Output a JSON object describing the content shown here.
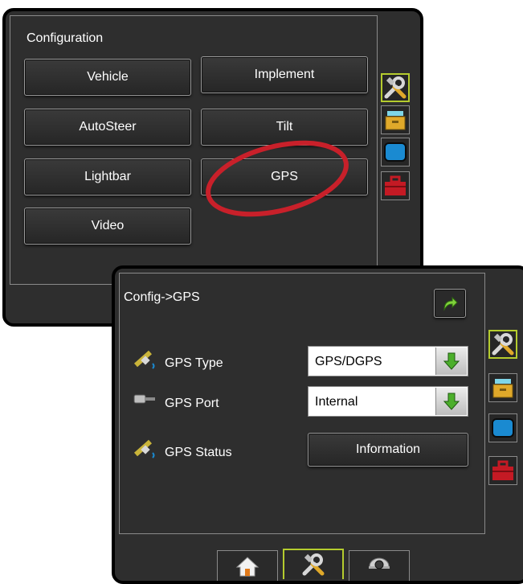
{
  "config": {
    "title": "Configuration",
    "buttons": {
      "vehicle": "Vehicle",
      "implement": "Implement",
      "autosteer": "AutoSteer",
      "tilt": "Tilt",
      "lightbar": "Lightbar",
      "gps": "GPS",
      "video": "Video"
    },
    "highlight_color": "#c8202a"
  },
  "gps": {
    "breadcrumb": "Config->GPS",
    "type_label": "GPS Type",
    "type_value": "GPS/DGPS",
    "port_label": "GPS Port",
    "port_value": "Internal",
    "status_label": "GPS Status",
    "status_button": "Information"
  },
  "side_tabs": [
    "tools-icon",
    "card-file-icon",
    "display-icon",
    "toolbox-icon"
  ],
  "bottom_nav": [
    "home-icon",
    "tools-icon",
    "camera-icon"
  ],
  "colors": {
    "accent": "#b5cc2e",
    "dropdown_arrow": "#4caf2b",
    "redo_arrow": "#7fd13b",
    "toolbox": "#c41a24",
    "display": "#1a8ad1",
    "file": "#e0a92a"
  }
}
